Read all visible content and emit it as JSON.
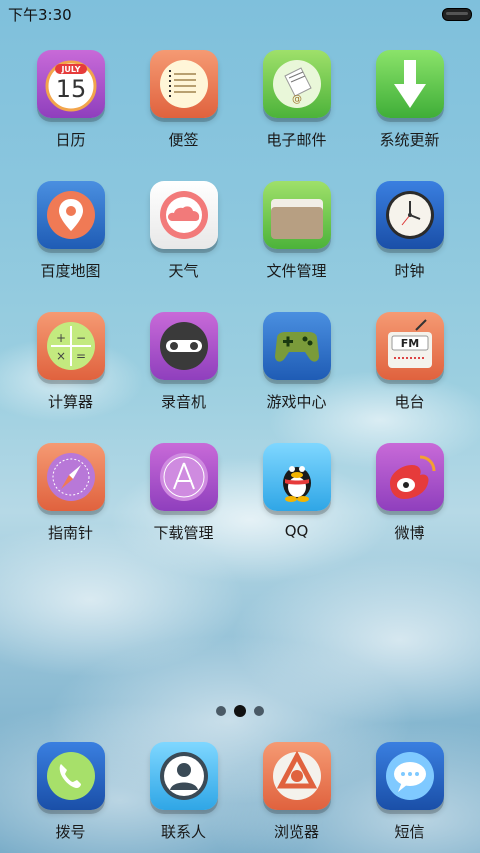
{
  "status": {
    "time": "下午3:30"
  },
  "apps": [
    {
      "label": "日历",
      "icon": "calendar-icon",
      "month": "JULY",
      "day": "15"
    },
    {
      "label": "便签",
      "icon": "notepad-icon"
    },
    {
      "label": "电子邮件",
      "icon": "mail-icon"
    },
    {
      "label": "系统更新",
      "icon": "download-arrow-icon"
    },
    {
      "label": "百度地图",
      "icon": "map-pin-icon"
    },
    {
      "label": "天气",
      "icon": "cloud-icon"
    },
    {
      "label": "文件管理",
      "icon": "folder-icon"
    },
    {
      "label": "时钟",
      "icon": "clock-icon"
    },
    {
      "label": "计算器",
      "icon": "calculator-icon"
    },
    {
      "label": "录音机",
      "icon": "cassette-icon"
    },
    {
      "label": "游戏中心",
      "icon": "gamepad-icon"
    },
    {
      "label": "电台",
      "icon": "radio-icon",
      "text": "FM"
    },
    {
      "label": "指南针",
      "icon": "compass-icon"
    },
    {
      "label": "下载管理",
      "icon": "app-store-icon"
    },
    {
      "label": "QQ",
      "icon": "penguin-icon"
    },
    {
      "label": "微博",
      "icon": "weibo-icon"
    }
  ],
  "page_indicator": {
    "count": 3,
    "active": 2
  },
  "dock": [
    {
      "label": "拨号",
      "icon": "phone-icon"
    },
    {
      "label": "联系人",
      "icon": "contact-icon"
    },
    {
      "label": "浏览器",
      "icon": "browser-icon"
    },
    {
      "label": "短信",
      "icon": "message-bubble-icon"
    }
  ]
}
